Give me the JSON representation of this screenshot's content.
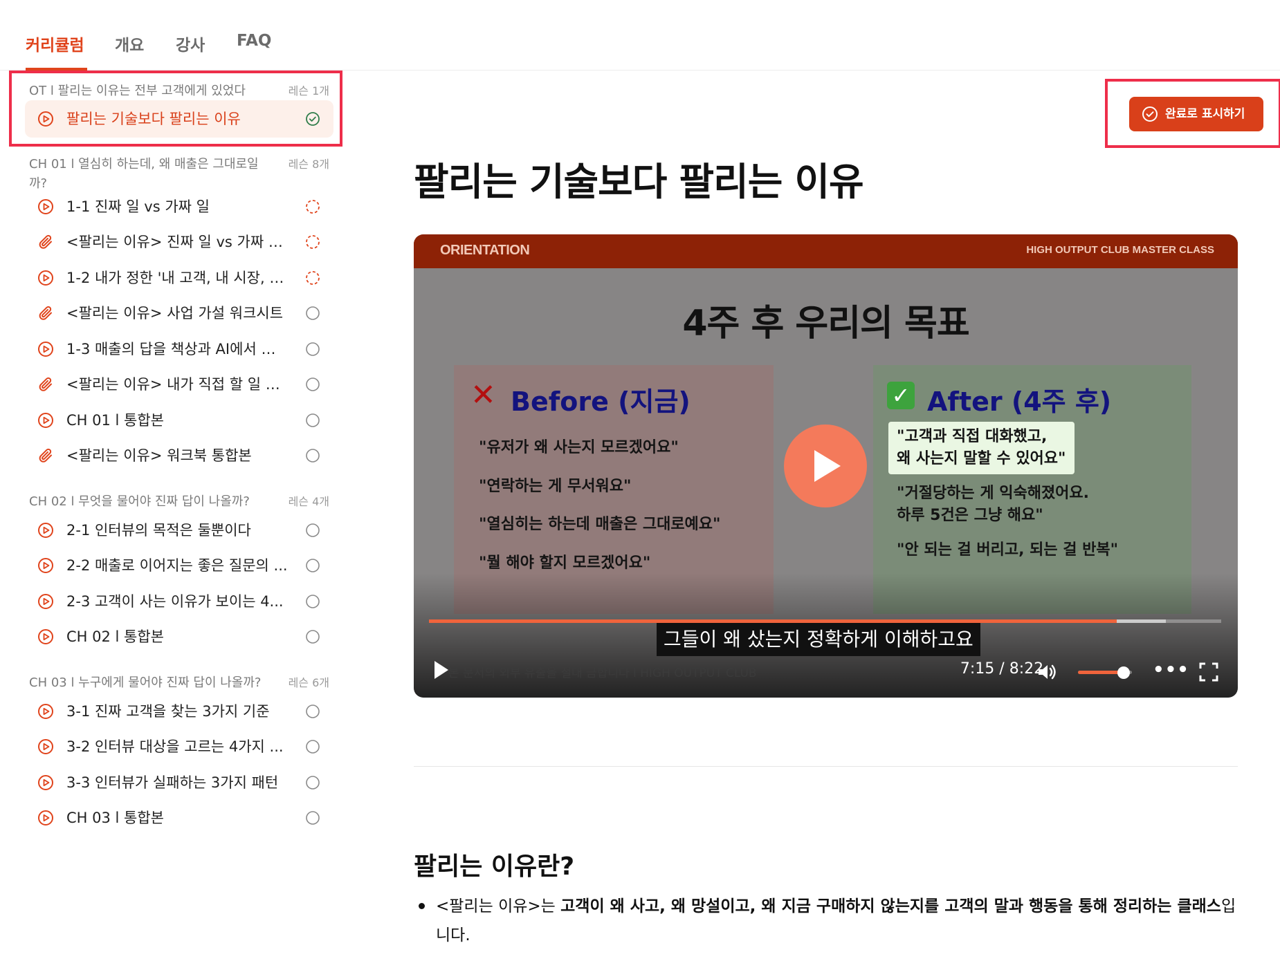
{
  "tabs": [
    {
      "label": "커리큘럼",
      "active": true
    },
    {
      "label": "개요",
      "active": false
    },
    {
      "label": "강사",
      "active": false
    },
    {
      "label": "FAQ",
      "active": false
    }
  ],
  "sidebar": {
    "sections": [
      {
        "title": "OT l 팔리는 이유는 전부 고객에게 있었다",
        "count": "레슨 1개",
        "lessons": [
          {
            "title": "팔리는 기술보다 팔리는 이유",
            "type": "play-icon",
            "status": "completed"
          }
        ]
      },
      {
        "title": "CH 01 l 열심히 하는데, 왜 매출은 그대로일까?",
        "count": "레슨 8개",
        "lessons": [
          {
            "title": "1-1 진짜 일 vs 가짜 일",
            "type": "play-icon",
            "status": "in-progress"
          },
          {
            "title": "<팔리는 이유> 진짜 일 vs 가짜 일 ...",
            "type": "paperclip-icon",
            "status": "in-progress"
          },
          {
            "title": "1-2 내가 정한 '내 고객, 내 시장, 내...",
            "type": "play-icon",
            "status": "in-progress"
          },
          {
            "title": "<팔리는 이유> 사업 가설 워크시트",
            "type": "paperclip-icon",
            "status": "not-started"
          },
          {
            "title": "1-3 매출의 답을 책상과 AI에서 찾...",
            "type": "play-icon",
            "status": "not-started"
          },
          {
            "title": "<팔리는 이유> 내가 직접 할 일 vs ...",
            "type": "paperclip-icon",
            "status": "not-started"
          },
          {
            "title": "CH 01 l 통합본",
            "type": "play-icon",
            "status": "not-started"
          },
          {
            "title": "<팔리는 이유> 워크북 통합본",
            "type": "paperclip-icon",
            "status": "not-started"
          }
        ]
      },
      {
        "title": "CH 02 l 무엇을 물어야 진짜 답이 나올까?",
        "count": "레슨 4개",
        "lessons": [
          {
            "title": "2-1 인터뷰의 목적은 둘뿐이다",
            "type": "play-icon",
            "status": "not-started"
          },
          {
            "title": "2-2 매출로 이어지는 좋은 질문의 ...",
            "type": "play-icon",
            "status": "not-started"
          },
          {
            "title": "2-3 고객이 사는 이유가 보이는 4...",
            "type": "play-icon",
            "status": "not-started"
          },
          {
            "title": "CH 02 l 통합본",
            "type": "play-icon",
            "status": "not-started"
          }
        ]
      },
      {
        "title": "CH 03 l 누구에게 물어야 진짜 답이 나올까?",
        "count": "레슨 6개",
        "lessons": [
          {
            "title": "3-1 진짜 고객을 찾는 3가지 기준",
            "type": "play-icon",
            "status": "not-started"
          },
          {
            "title": "3-2 인터뷰 대상을 고르는 4가지 ...",
            "type": "play-icon",
            "status": "not-started"
          },
          {
            "title": "3-3 인터뷰가 실패하는 3가지 패턴",
            "type": "play-icon",
            "status": "not-started"
          },
          {
            "title": "CH 03 l 통합본",
            "type": "play-icon",
            "status": "not-started"
          }
        ]
      }
    ]
  },
  "main": {
    "complete_button": "완료로 표시하기",
    "title": "팔리는 기술보다 팔리는 이유",
    "video": {
      "top_left": "ORIENTATION",
      "top_right": "HIGH OUTPUT CLUB MASTER CLASS",
      "heading": "4주 후 우리의 목표",
      "before": {
        "title": "Before (지금)",
        "quotes": [
          "\"유저가 왜 사는지 모르겠어요\"",
          "\"연락하는 게 무서워요\"",
          "\"열심히는 하는데 매출은 그대로예요\"",
          "\"뭘 해야 할지 모르겠어요\""
        ]
      },
      "after": {
        "title": "After (4주 후)",
        "quotes": [
          {
            "line1": "\"고객과 직접 대화했고,",
            "line2": "왜 사는지 말할 수 있어요\""
          },
          {
            "line1": "\"거절당하는 게 익숙해졌어요.",
            "line2": "하루 5건은 그냥 해요\""
          },
          {
            "line1": "\"안 되는 걸 버리고, 되는 걸 반복\"",
            "line2": ""
          }
        ]
      },
      "subtitle": "그들이 왜 샀는지 정확하게 이해하고요",
      "watermark": "본 문서의 외부 유출을 절대 금합니다 l HIGH OUTPUT CLUB",
      "time": "7:15 / 8:22",
      "progress": 0.868,
      "buffered": 0.93,
      "volume": 0.85,
      "accent": "#f0643c"
    },
    "section_heading": "팔리는 이유란?",
    "bullet": {
      "lead": "<팔리는 이유>는 ",
      "bold": "고객이 왜 사고, 왜 망설이고, 왜 지금 구매하지 않는지를 고객의 말과 행동을 통해 정리하는 클래스",
      "tail": "입니다."
    }
  },
  "colors": {
    "accent": "#e0441c",
    "highlight_border": "#ee2e4a"
  }
}
